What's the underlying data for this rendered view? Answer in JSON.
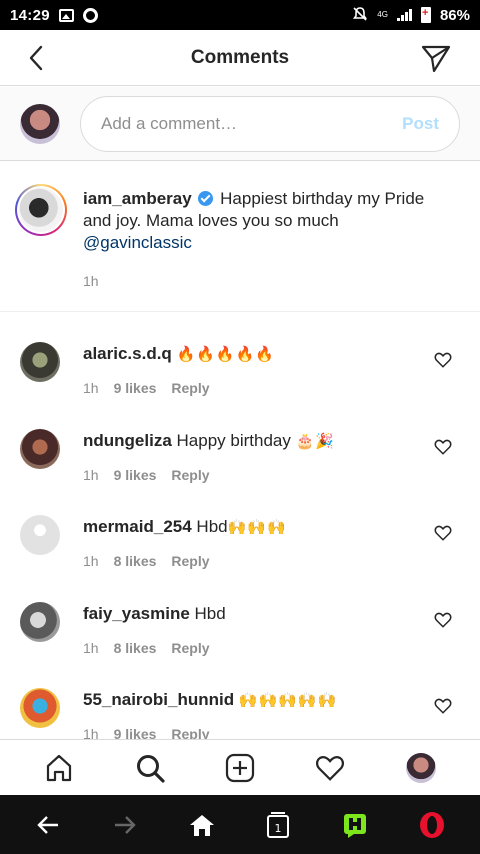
{
  "status_bar": {
    "time": "14:29",
    "battery_percent": "86%",
    "network": "4G"
  },
  "header": {
    "title": "Comments",
    "back_icon": "chevron-left-icon",
    "send_icon": "paper-plane-icon"
  },
  "add_comment": {
    "placeholder": "Add a comment…",
    "post_label": "Post",
    "post_color": "#b2dffc"
  },
  "caption": {
    "username": "iam_amberay",
    "verified": true,
    "text": "Happiest birthday my Pride and joy. Mama loves you so much",
    "mention": "@gavinclassic",
    "time": "1h"
  },
  "comments": [
    {
      "username": "alaric.s.d.q",
      "text": "",
      "emoji": "🔥🔥🔥🔥🔥",
      "time": "1h",
      "likes": "9 likes",
      "reply": "Reply"
    },
    {
      "username": "ndungeliza",
      "text": "Happy birthday",
      "emoji": "🎂🎉",
      "time": "1h",
      "likes": "9 likes",
      "reply": "Reply"
    },
    {
      "username": "mermaid_254",
      "text": "Hbd",
      "emoji": "🙌🙌🙌",
      "time": "1h",
      "likes": "8 likes",
      "reply": "Reply"
    },
    {
      "username": "faiy_yasmine",
      "text": "Hbd",
      "emoji": "",
      "time": "1h",
      "likes": "8 likes",
      "reply": "Reply"
    },
    {
      "username": "55_nairobi_hunnid",
      "text": "",
      "emoji": "🙌🙌🙌🙌🙌",
      "time": "1h",
      "likes": "9 likes",
      "reply": "Reply"
    }
  ],
  "bottom_nav": [
    "home-icon",
    "search-icon",
    "add-post-icon",
    "activity-heart-icon",
    "profile-avatar"
  ],
  "system_nav": [
    "back-arrow-icon",
    "forward-arrow-icon",
    "home-icon",
    "tabs-icon",
    "hype-icon",
    "opera-icon"
  ],
  "system_nav_tab_count": "1",
  "colors": {
    "link": "#003569",
    "verified": "#3897f0",
    "muted": "#8e8e8e",
    "hype_green": "#7ce51d",
    "opera_red": "#e8112d"
  }
}
